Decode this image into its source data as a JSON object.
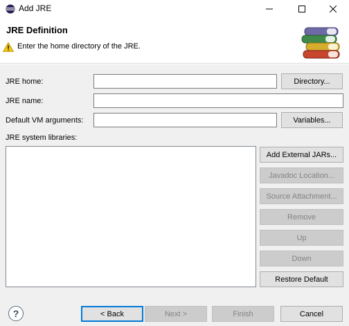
{
  "window": {
    "title": "Add JRE",
    "minimize_icon": "minimize-icon",
    "maximize_icon": "maximize-icon",
    "close_icon": "close-icon"
  },
  "banner": {
    "title": "JRE Definition",
    "message": "Enter the home directory of the JRE.",
    "message_icon": "warning-icon",
    "art_icon": "books-icon"
  },
  "form": {
    "jre_home_label": "JRE home:",
    "jre_home_value": "",
    "directory_button": "Directory...",
    "jre_name_label": "JRE name:",
    "jre_name_value": "",
    "vm_args_label": "Default VM arguments:",
    "vm_args_value": "",
    "variables_button": "Variables...",
    "libraries_label": "JRE system libraries:",
    "libraries": []
  },
  "library_buttons": {
    "add_external_jars": "Add External JARs...",
    "javadoc_location": "Javadoc Location...",
    "source_attachment": "Source Attachment...",
    "remove": "Remove",
    "up": "Up",
    "down": "Down",
    "restore_default": "Restore Default"
  },
  "footer": {
    "help_icon": "help-icon",
    "back": "< Back",
    "next": "Next >",
    "finish": "Finish",
    "cancel": "Cancel"
  },
  "colors": {
    "content_bg": "#f0f0f0",
    "default_button_border": "#0078d7",
    "disabled_text": "#838383",
    "warning": "#f2c811"
  }
}
